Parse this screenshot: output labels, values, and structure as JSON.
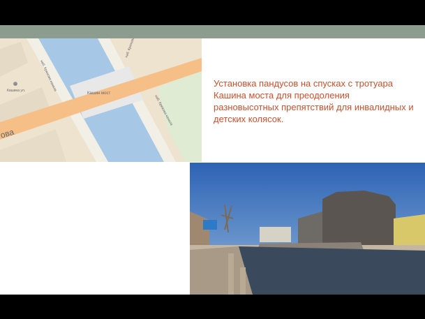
{
  "slide": {
    "description": "Установка пандусов на спусках с тротуара Кашина моста  для преодоления разновысотных препятствий для инвалидных и детских колясок."
  },
  "map": {
    "bridge_label": "Кашин мост",
    "embankment_upper": "наб. Крюкова канала",
    "embankment_right": "наб. Крюкова канала",
    "embankment_left": "наб. Крюкова канала",
    "street_label": "ова",
    "house_number": "11",
    "house_caption": "Кашина ул."
  },
  "colors": {
    "text_accent": "#c8502e",
    "band": "#8c9c8e",
    "water": "#a6c8e6",
    "road": "#f6bf88",
    "map_ground": "#eee3cf"
  }
}
